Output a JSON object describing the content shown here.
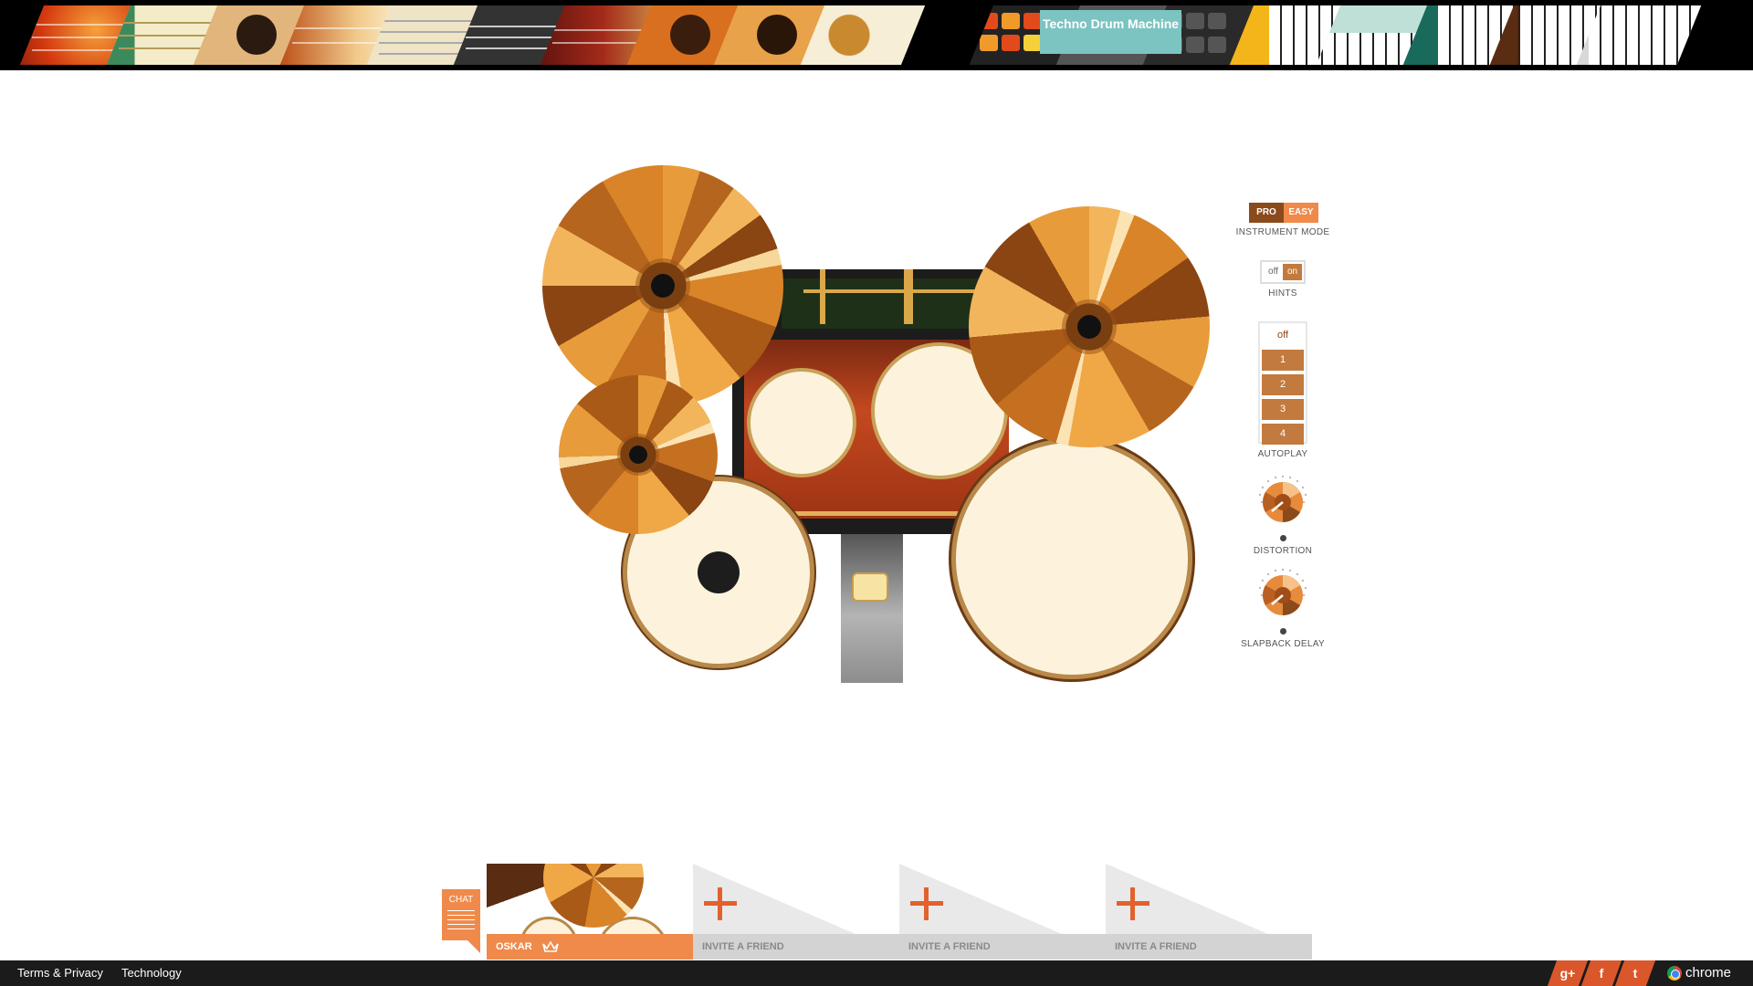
{
  "header": {
    "active_instrument": "Techno Drum Machine",
    "instruments_left": [
      "bass-guitar-1",
      "bass-guitar-2",
      "acoustic-guitar-1",
      "electric-guitar-1",
      "electric-guitar-2",
      "electric-guitar-3",
      "electric-guitar-4",
      "acoustic-guitar-2",
      "acoustic-guitar-3",
      "drum-kit"
    ],
    "instruments_right": [
      "drum-machine",
      "techno-drum-machine",
      "drum-pad",
      "keyboard-1",
      "keyboard-2",
      "keyboard-3",
      "keyboard-4",
      "keyboard-5"
    ]
  },
  "controls": {
    "instrument_mode": {
      "label": "INSTRUMENT MODE",
      "options": [
        "PRO",
        "EASY"
      ],
      "selected": "EASY"
    },
    "hints": {
      "label": "HINTS",
      "options": [
        "off",
        "on"
      ],
      "selected": "on"
    },
    "autoplay": {
      "label": "AUTOPLAY",
      "options": [
        "off",
        "1",
        "2",
        "3",
        "4"
      ],
      "selected": "off"
    },
    "distortion": {
      "label": "DISTORTION"
    },
    "slapback_delay": {
      "label": "SLAPBACK DELAY"
    }
  },
  "players": {
    "chat_label": "CHAT",
    "slots": [
      {
        "name": "OSKAR",
        "host": true
      },
      {
        "name": "INVITE A FRIEND",
        "host": false
      },
      {
        "name": "INVITE A FRIEND",
        "host": false
      },
      {
        "name": "INVITE A FRIEND",
        "host": false
      }
    ]
  },
  "footer": {
    "links": [
      "Terms & Privacy",
      "Technology"
    ],
    "social": [
      "g+",
      "f",
      "t"
    ],
    "brand": "chrome"
  },
  "colors": {
    "accent_orange": "#f08a4b",
    "active_label_bg": "#7cc4c1",
    "drum_head": "#fdf3dc",
    "autoplay_btn": "#c27a3e"
  }
}
